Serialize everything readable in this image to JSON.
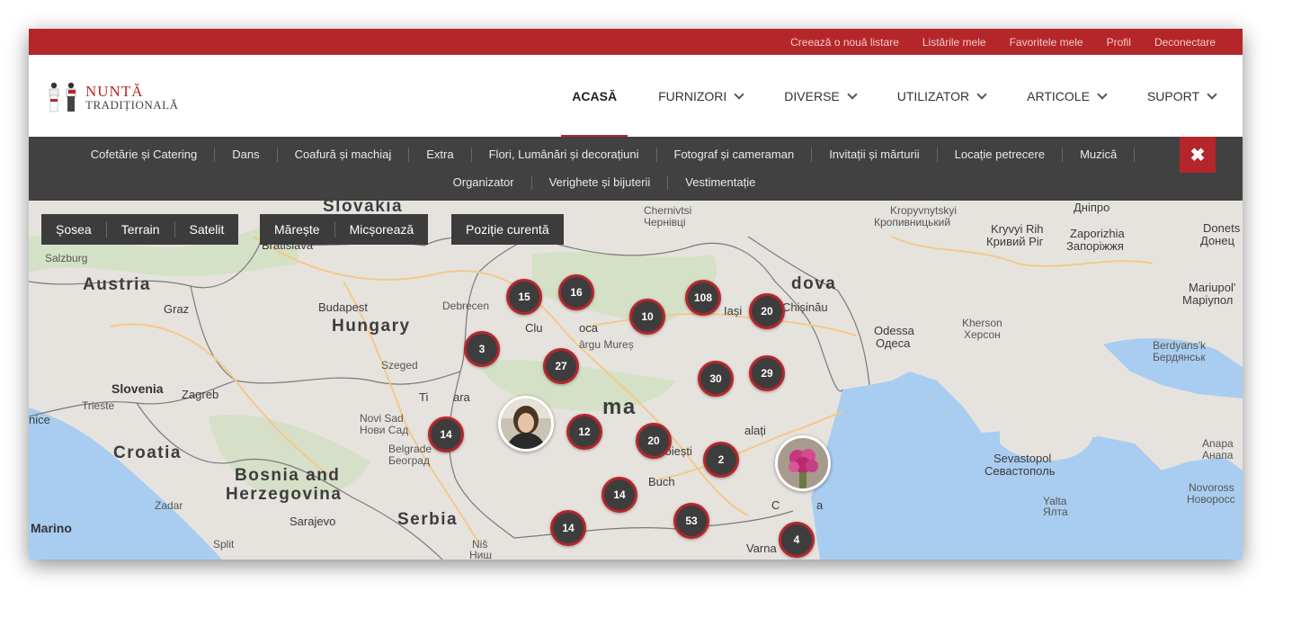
{
  "topbar": {
    "links": [
      "Creează o nouă listare",
      "Listările mele",
      "Favoritele mele",
      "Profil",
      "Deconectare"
    ]
  },
  "logo": {
    "line1": "Nuntă",
    "line2": "Tradițională"
  },
  "nav": {
    "items": [
      {
        "label": "ACASĂ",
        "active": true
      },
      {
        "label": "FURNIZORI"
      },
      {
        "label": "DIVERSE"
      },
      {
        "label": "UTILIZATOR"
      },
      {
        "label": "ARTICOLE"
      },
      {
        "label": "SUPORT"
      }
    ]
  },
  "categories": {
    "row1": [
      "Cofetărie și Catering",
      "Dans",
      "Coafură și machiaj",
      "Extra",
      "Flori, Lumânări și decorațiuni",
      "Fotograf și cameraman",
      "Invitații și mărturii",
      "Locație petrecere",
      "Muzică"
    ],
    "row2": [
      "Organizator",
      "Verighete și bijuterii",
      "Vestimentație"
    ],
    "close_icon": "✖"
  },
  "map_controls": {
    "type": [
      "Șosea",
      "Terrain",
      "Satelit"
    ],
    "zoom": [
      "Mărește",
      "Micșorează"
    ],
    "position": "Poziție curentă"
  },
  "clusters": [
    {
      "count": "15"
    },
    {
      "count": "16"
    },
    {
      "count": "10"
    },
    {
      "count": "108"
    },
    {
      "count": "20"
    },
    {
      "count": "3"
    },
    {
      "count": "27"
    },
    {
      "count": "30"
    },
    {
      "count": "29"
    },
    {
      "count": "14"
    },
    {
      "count": "12"
    },
    {
      "count": "20"
    },
    {
      "count": "2"
    },
    {
      "count": "14"
    },
    {
      "count": "53"
    },
    {
      "count": "14"
    },
    {
      "count": "4"
    }
  ],
  "map_labels": {
    "slovakia": "Slovakia",
    "austria": "Austria",
    "hungary": "Hungary",
    "slovenia": "Slovenia",
    "croatia": "Croatia",
    "bosnia1": "Bosnia and",
    "bosnia2": "Herzegovina",
    "serbia": "Serbia",
    "marino": "Marino",
    "moldova_part": "dova",
    "romania_part": "ma",
    "salzburg": "Salzburg",
    "bratislava": "Bratislava",
    "budapest": "Budapest",
    "graz": "Graz",
    "debrecen": "Debrecen",
    "szeged": "Szeged",
    "zagreb": "Zagreb",
    "trieste": "Trieste",
    "nice": "nice",
    "novisad1": "Novi Sad",
    "novisad2": "Нови Сад",
    "belgrade1": "Belgrade",
    "belgrade2": "Београд",
    "zadar": "Zadar",
    "sarajevo": "Sarajevo",
    "split": "Split",
    "nis1": "Niš",
    "nis2": "Ниш",
    "varna": "Varna",
    "chernivtsi1": "Chernivtsi",
    "chernivtsi2": "Чернівці",
    "iasi": "Iași",
    "chisinau": "Chișinău",
    "odessa1": "Odessa",
    "odessa2": "Одеса",
    "kherson1": "Kherson",
    "kherson2": "Херсон",
    "kropyv1": "Kropyvnytskyi",
    "kropyv2": "Кропивницький",
    "kryvyi1": "Kryvyi Rih",
    "kryvyi2": "Кривий Ріг",
    "zapor1": "Zaporizhia",
    "zapor2": "Запоріжжя",
    "dnipro": "Дніпро",
    "donets1": "Donets",
    "donets2": "Донец",
    "mariupol1": "Mariupol'",
    "mariupol2": "Маріупол",
    "berdyansk1": "Berdyans'k",
    "berdyansk2": "Бердянськ",
    "sevastopol1": "Sevastopol",
    "sevastopol2": "Севастополь",
    "yalta1": "Yalta",
    "yalta2": "Ялта",
    "anapa1": "Anapa",
    "anapa2": "Анапа",
    "novoross1": "Novoross",
    "novoross2": "Новоросс",
    "ploiesti": "Ploiești",
    "buch": "Buch",
    "galati_part": "alați",
    "cluj_part": "Clu",
    "cluj_part2": "oca",
    "targu_part": "ârgu Mureș",
    "timis_part": "Ti",
    "timis_part2": "ara",
    "constanta_part": "C",
    "constanta_part2": "a"
  },
  "colors": {
    "brand": "#b5262b",
    "bar": "#414141",
    "water": "#a9cdf0",
    "land": "#e6e3de"
  }
}
